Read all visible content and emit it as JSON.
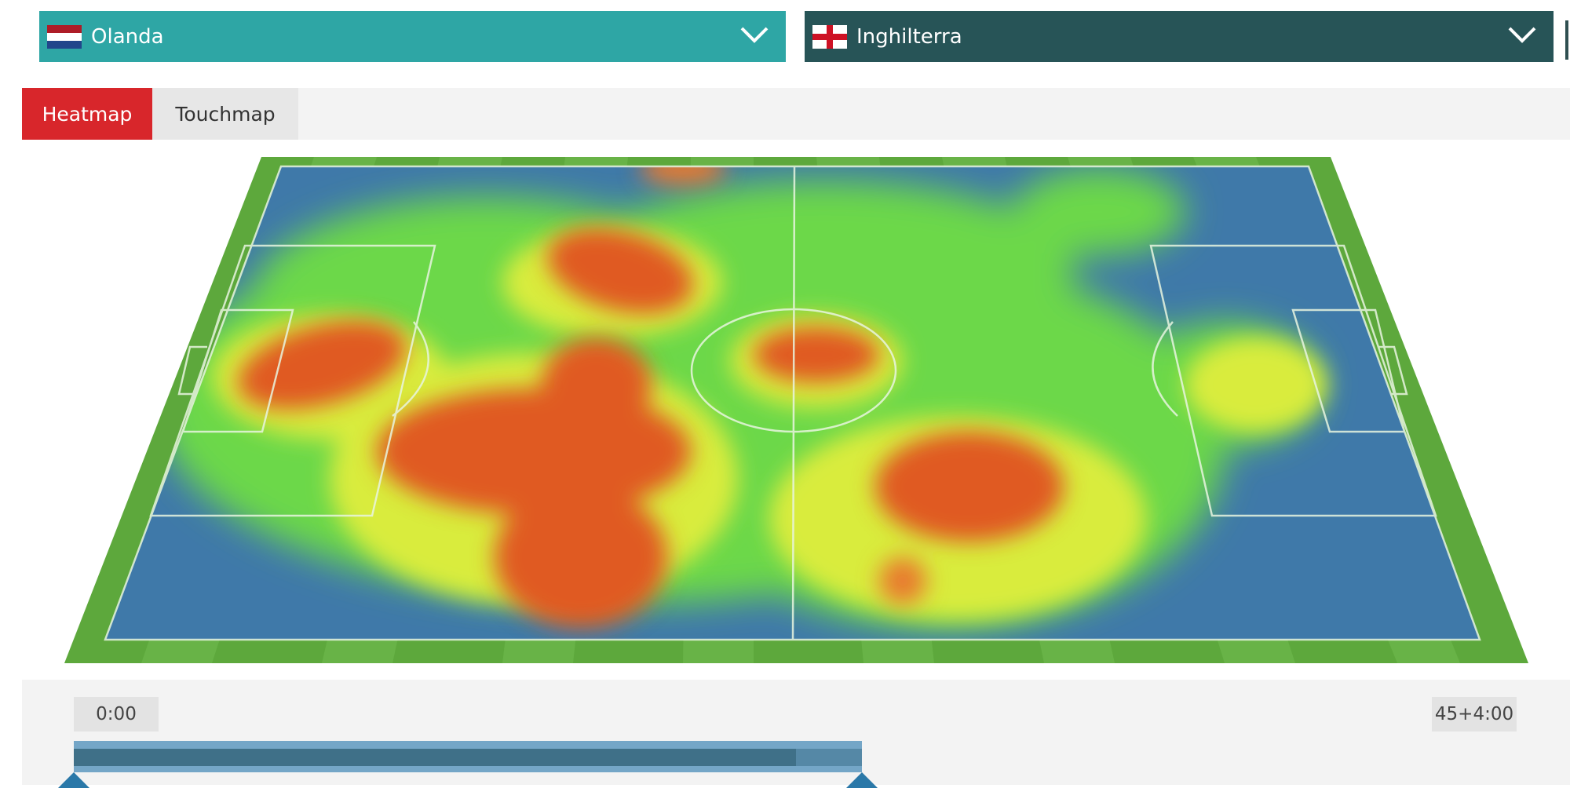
{
  "teams": {
    "home": {
      "name": "Olanda",
      "flag_icon": "netherlands-flag-icon",
      "color": "#2ea6a5"
    },
    "away": {
      "name": "Inghilterra",
      "flag_icon": "england-flag-icon",
      "color": "#275457"
    }
  },
  "tabs": [
    {
      "label": "Heatmap",
      "active": true,
      "color": "#d8262b"
    },
    {
      "label": "Touchmap",
      "active": false
    }
  ],
  "timeline": {
    "start_label": "0:00",
    "end_label": "45+4:00",
    "selected_fraction": 0.5
  },
  "pitch": {
    "grass_color": "#5da83c",
    "line_color": "#e8f5e0"
  }
}
